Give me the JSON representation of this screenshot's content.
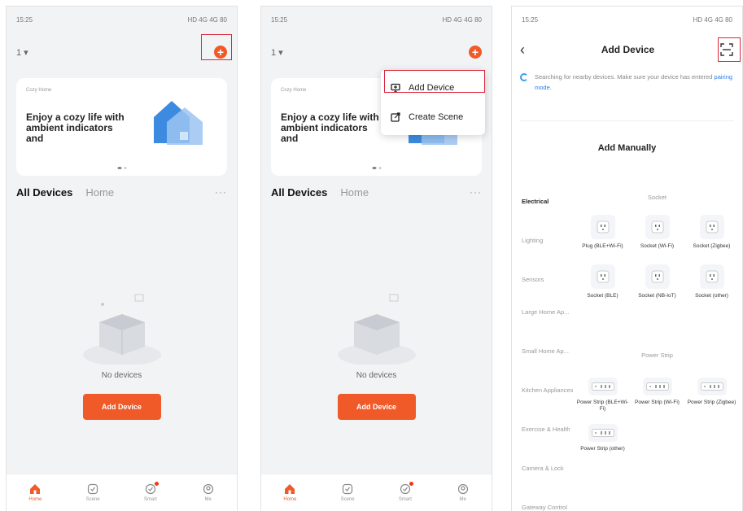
{
  "status": {
    "time": "15:25",
    "right": "HD 4G 4G 80"
  },
  "home": {
    "selector": "1 ▾",
    "banner_small": "Cozy Home",
    "banner_title": "Enjoy a cozy life with ambient indicators and",
    "tab_all": "All Devices",
    "tab_home": "Home",
    "more": "···",
    "empty_text": "No devices",
    "add_button": "Add Device"
  },
  "tabbar": [
    {
      "label": "Home",
      "icon": "home-icon"
    },
    {
      "label": "Scene",
      "icon": "scene-icon"
    },
    {
      "label": "Smart",
      "icon": "smart-icon"
    },
    {
      "label": "Me",
      "icon": "me-icon"
    }
  ],
  "popup": {
    "add_device": "Add Device",
    "create_scene": "Create Scene"
  },
  "add_device_page": {
    "title": "Add Device",
    "search_text": "Searching for nearby devices. Make sure your device has entered",
    "search_link": "pairing mode.",
    "manual_title": "Add Manually",
    "categories": [
      "Electrical",
      "Lighting",
      "Sensors",
      "Large Home Ap...",
      "Small Home Ap...",
      "Kitchen Appliances",
      "Exercise & Health",
      "Camera & Lock",
      "Gateway Control"
    ],
    "section_socket": "Socket",
    "section_strip": "Power Strip",
    "sockets": [
      "Plug (BLE+Wi-Fi)",
      "Socket (Wi-Fi)",
      "Socket (Zigbee)",
      "Socket (BLE)",
      "Socket (NB-IoT)",
      "Socket (other)"
    ],
    "strips": [
      "Power Strip (BLE+Wi-Fi)",
      "Power Strip (Wi-Fi)",
      "Power Strip (Zigbee)",
      "Power Strip (other)"
    ]
  },
  "colors": {
    "accent": "#f05a28",
    "highlight": "#d9263b",
    "link": "#2b7de9"
  }
}
